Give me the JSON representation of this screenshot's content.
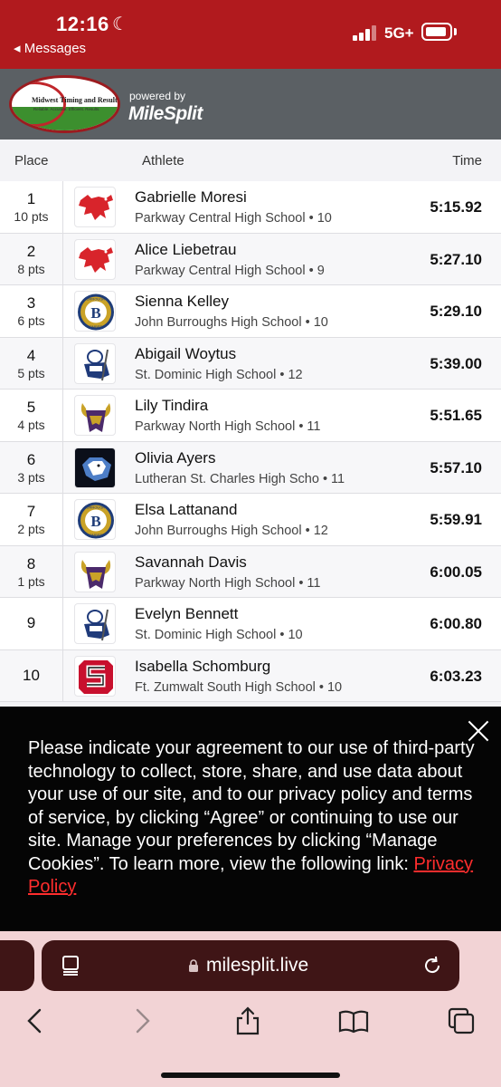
{
  "status_bar": {
    "time": "12:16",
    "network": "5G+",
    "back_label": "◂ Messages"
  },
  "header": {
    "logo_title": "Midwest Timing and Results",
    "logo_subtitle": "Reliable. Accurate. Efficient. Results.",
    "powered_by": "powered by",
    "brand": "MileSplit"
  },
  "table": {
    "headers": {
      "place": "Place",
      "athlete": "Athlete",
      "time": "Time"
    },
    "rows": [
      {
        "place": "1",
        "pts": "10 pts",
        "name": "Gabrielle Moresi",
        "school": "Parkway Central High School • 10",
        "time": "5:15.92",
        "logo": "red-mustang-logo"
      },
      {
        "place": "2",
        "pts": "8 pts",
        "name": "Alice Liebetrau",
        "school": "Parkway Central High School • 9",
        "time": "5:27.10",
        "logo": "red-mustang-logo"
      },
      {
        "place": "3",
        "pts": "6 pts",
        "name": "Sienna Kelley",
        "school": "John Burroughs High School • 10",
        "time": "5:29.10",
        "logo": "burroughs-bombers-logo"
      },
      {
        "place": "4",
        "pts": "5 pts",
        "name": "Abigail Woytus",
        "school": "St. Dominic High School • 12",
        "time": "5:39.00",
        "logo": "crusader-logo"
      },
      {
        "place": "5",
        "pts": "4 pts",
        "name": "Lily Tindira",
        "school": "Parkway North High School • 11",
        "time": "5:51.65",
        "logo": "viking-logo"
      },
      {
        "place": "6",
        "pts": "3 pts",
        "name": "Olivia Ayers",
        "school": "Lutheran St. Charles High Scho • 11",
        "time": "5:57.10",
        "logo": "cougar-logo"
      },
      {
        "place": "7",
        "pts": "2 pts",
        "name": "Elsa Lattanand",
        "school": "John Burroughs High School • 12",
        "time": "5:59.91",
        "logo": "burroughs-bombers-logo"
      },
      {
        "place": "8",
        "pts": "1 pts",
        "name": "Savannah Davis",
        "school": "Parkway North High School • 11",
        "time": "6:00.05",
        "logo": "viking-logo"
      },
      {
        "place": "9",
        "pts": "",
        "name": "Evelyn Bennett",
        "school": "St. Dominic High School • 10",
        "time": "6:00.80",
        "logo": "crusader-logo"
      },
      {
        "place": "10",
        "pts": "",
        "name": "Isabella Schomburg",
        "school": "Ft. Zumwalt South High School • 10",
        "time": "6:03.23",
        "logo": "zumwalt-s-logo"
      }
    ]
  },
  "logos": {
    "burroughs_top": "BURROUGHS",
    "burroughs_letter": "B",
    "burroughs_bottom": "BOMBERS"
  },
  "cookie_banner": {
    "text": "Please indicate your agreement to our use of third-party technology to collect, store, share, and use data about your use of our site, and to our privacy policy and terms of service, by clicking “Agree” or continuing to use our site. Manage your preferences by clicking “Manage Cookies”. To learn more, view the following link: ",
    "link_label": "Privacy Policy"
  },
  "browser": {
    "url": "milesplit.live"
  },
  "colors": {
    "status_red": "#b11a1e",
    "header_gray": "#5b6064",
    "url_bar": "#3f1516",
    "link_red": "#ff2d2d"
  }
}
